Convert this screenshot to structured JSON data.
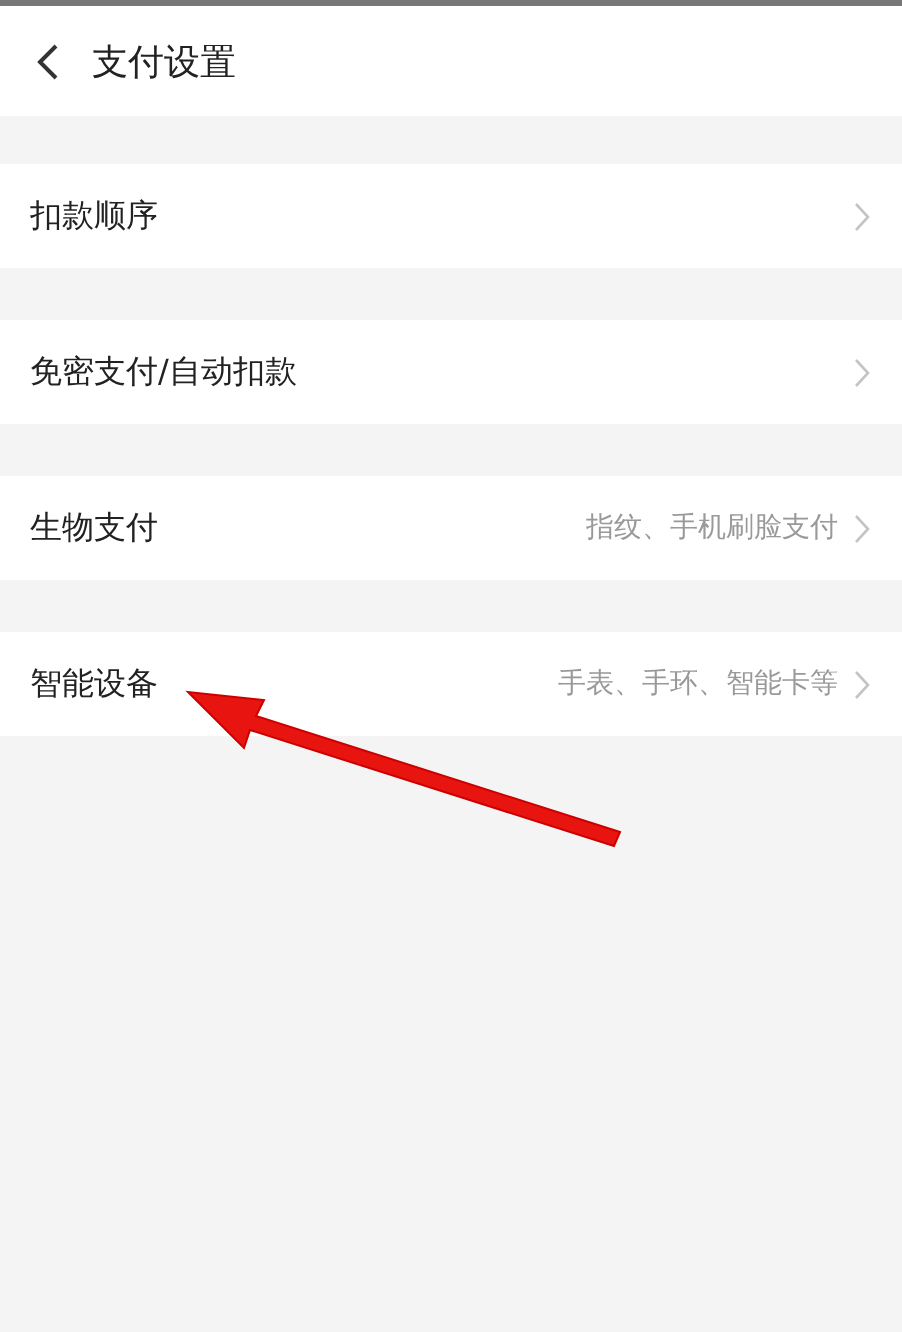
{
  "header": {
    "title": "支付设置"
  },
  "items": [
    {
      "label": "扣款顺序"
    },
    {
      "label": "免密支付/自动扣款"
    },
    {
      "label": "生物支付",
      "detail": "指纹、手机刷脸支付"
    },
    {
      "label": "智能设备",
      "detail": "手表、手环、智能卡等"
    }
  ]
}
